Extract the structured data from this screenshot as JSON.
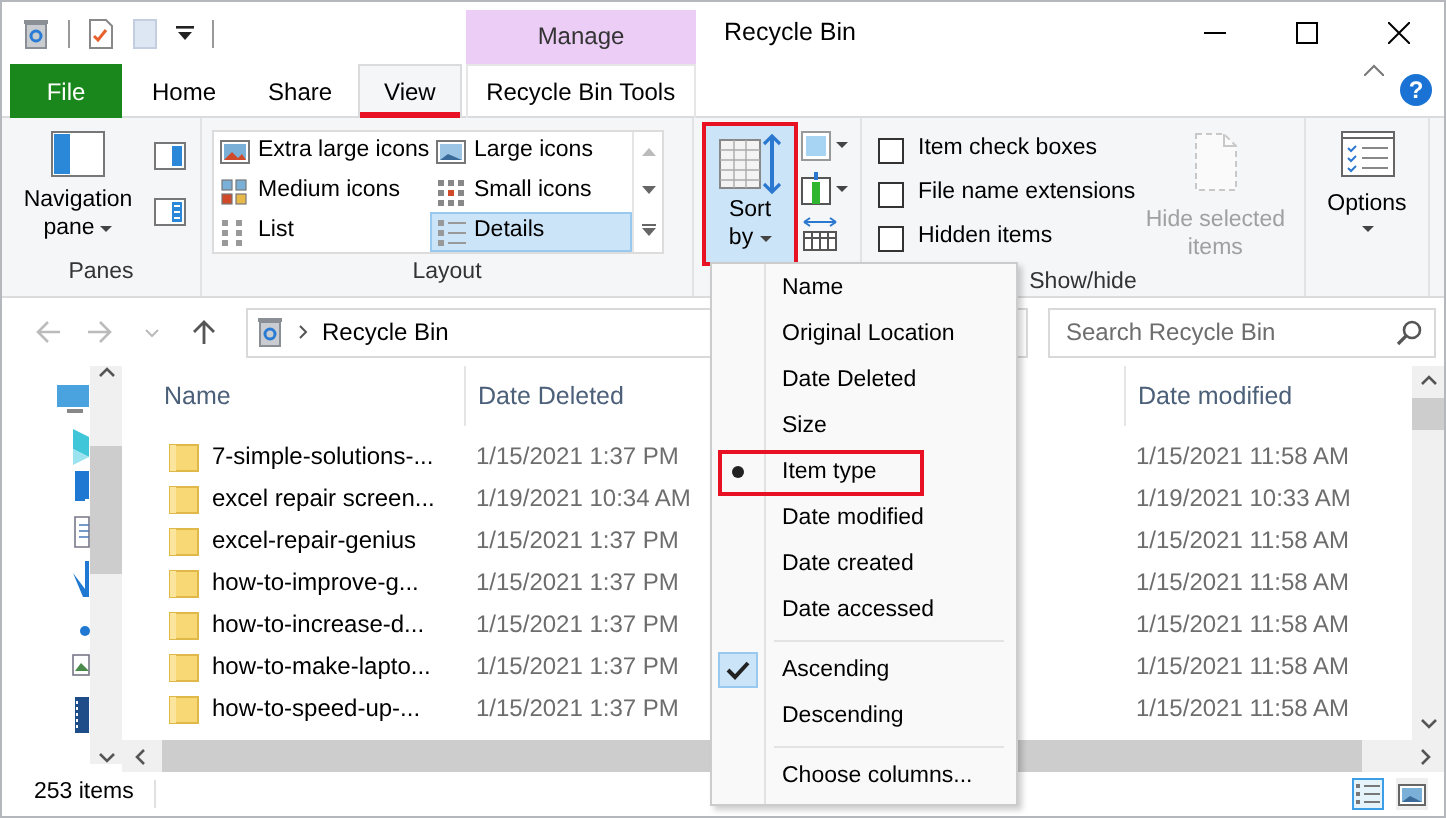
{
  "window": {
    "title": "Recycle Bin",
    "contextual_header": "Manage",
    "help": "?"
  },
  "tabs": [
    {
      "label": "File",
      "kind": "file",
      "selected": false,
      "highlight": false
    },
    {
      "label": "Home",
      "kind": "plain",
      "selected": false,
      "highlight": false
    },
    {
      "label": "Share",
      "kind": "plain",
      "selected": false,
      "highlight": false
    },
    {
      "label": "View",
      "kind": "plain",
      "selected": true,
      "highlight": true
    },
    {
      "label": "Recycle Bin Tools",
      "kind": "contextual",
      "selected": false,
      "highlight": false
    }
  ],
  "panes": {
    "label": "Panes",
    "navigation_pane": "Navigation pane"
  },
  "layout": {
    "label": "Layout",
    "options": [
      {
        "label": "Extra large icons",
        "selected": false
      },
      {
        "label": "Large icons",
        "selected": false
      },
      {
        "label": "Medium icons",
        "selected": false
      },
      {
        "label": "Small icons",
        "selected": false
      },
      {
        "label": "List",
        "selected": false
      },
      {
        "label": "Details",
        "selected": true
      }
    ]
  },
  "current_view": {
    "sort_button": {
      "label": "Sort by",
      "highlight": true
    }
  },
  "show_hide": {
    "label": "Show/hide",
    "checkboxes": [
      {
        "label": "Item check boxes",
        "checked": false
      },
      {
        "label": "File name extensions",
        "checked": false
      },
      {
        "label": "Hidden items",
        "checked": false
      }
    ],
    "hide_selected": {
      "label": "Hide selected items",
      "disabled": true
    }
  },
  "options": {
    "label": "Options"
  },
  "address": {
    "path": "Recycle Bin"
  },
  "search": {
    "placeholder": "Search Recycle Bin"
  },
  "file_list": {
    "columns": [
      "Name",
      "Date Deleted",
      "Date modified"
    ],
    "rows": [
      {
        "name": "7-simple-solutions-...",
        "date_deleted": "1/15/2021 1:37 PM",
        "date_modified": "1/15/2021 11:58 AM"
      },
      {
        "name": "excel repair screen...",
        "date_deleted": "1/19/2021 10:34 AM",
        "date_modified": "1/19/2021 10:33 AM"
      },
      {
        "name": "excel-repair-genius",
        "date_deleted": "1/15/2021 1:37 PM",
        "date_modified": "1/15/2021 11:58 AM"
      },
      {
        "name": "how-to-improve-g...",
        "date_deleted": "1/15/2021 1:37 PM",
        "date_modified": "1/15/2021 11:58 AM"
      },
      {
        "name": "how-to-increase-d...",
        "date_deleted": "1/15/2021 1:37 PM",
        "date_modified": "1/15/2021 11:58 AM"
      },
      {
        "name": "how-to-make-lapto...",
        "date_deleted": "1/15/2021 1:37 PM",
        "date_modified": "1/15/2021 11:58 AM"
      },
      {
        "name": "how-to-speed-up-...",
        "date_deleted": "1/15/2021 1:37 PM",
        "date_modified": "1/15/2021 11:58 AM"
      }
    ]
  },
  "sort_menu": {
    "items": [
      {
        "label": "Name",
        "kind": "sort",
        "selected": false,
        "highlight": false
      },
      {
        "label": "Original Location",
        "kind": "sort",
        "selected": false,
        "highlight": false
      },
      {
        "label": "Date Deleted",
        "kind": "sort",
        "selected": false,
        "highlight": false
      },
      {
        "label": "Size",
        "kind": "sort",
        "selected": false,
        "highlight": false
      },
      {
        "label": "Item type",
        "kind": "sort",
        "selected": true,
        "highlight": true
      },
      {
        "label": "Date modified",
        "kind": "sort",
        "selected": false,
        "highlight": false
      },
      {
        "label": "Date created",
        "kind": "sort",
        "selected": false,
        "highlight": false
      },
      {
        "label": "Date accessed",
        "kind": "sort",
        "selected": false,
        "highlight": false
      },
      {
        "label": "Ascending",
        "kind": "order",
        "selected": true,
        "highlight": false
      },
      {
        "label": "Descending",
        "kind": "order",
        "selected": false,
        "highlight": false
      },
      {
        "label": "Choose columns...",
        "kind": "action",
        "selected": false,
        "highlight": false
      }
    ]
  },
  "status_bar": {
    "item_count": "253 items",
    "views": [
      {
        "kind": "details",
        "selected": true
      },
      {
        "kind": "thumbnails",
        "selected": false
      }
    ]
  }
}
